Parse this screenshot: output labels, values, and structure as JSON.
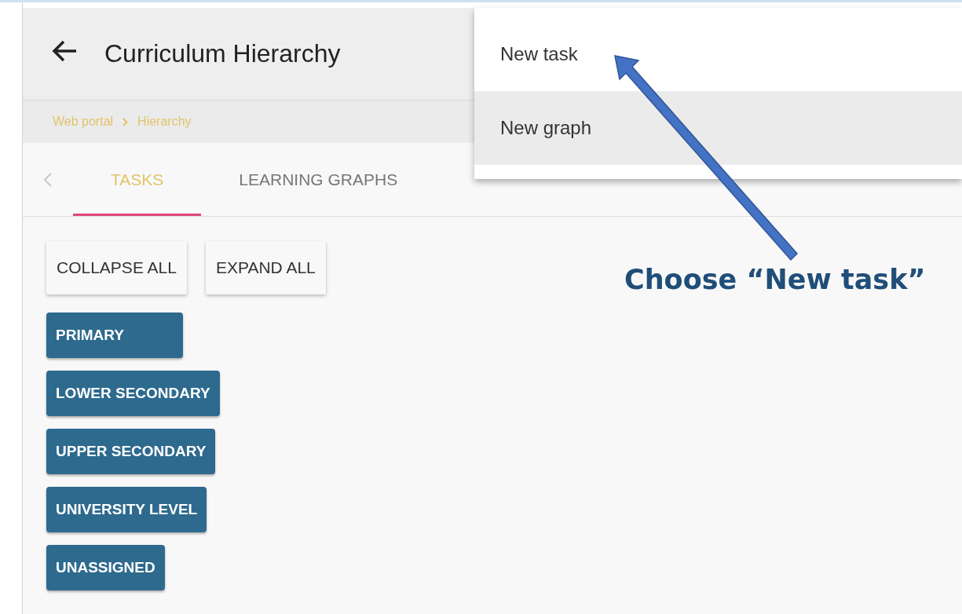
{
  "header": {
    "title": "Curriculum Hierarchy"
  },
  "breadcrumb": [
    "Web portal",
    "Hierarchy"
  ],
  "tabs": [
    {
      "label": "TASKS",
      "selected": true
    },
    {
      "label": "LEARNING GRAPHS",
      "selected": false
    }
  ],
  "toolbar_buttons": [
    "COLLAPSE ALL",
    "EXPAND ALL"
  ],
  "levels": [
    "PRIMARY",
    "LOWER SECONDARY",
    "UPPER SECONDARY",
    "UNIVERSITY LEVEL",
    "UNASSIGNED"
  ],
  "menu": [
    {
      "label": "New task",
      "highlighted": false
    },
    {
      "label": "New graph",
      "highlighted": true
    }
  ],
  "annotation": {
    "text": "Choose “New task”"
  }
}
